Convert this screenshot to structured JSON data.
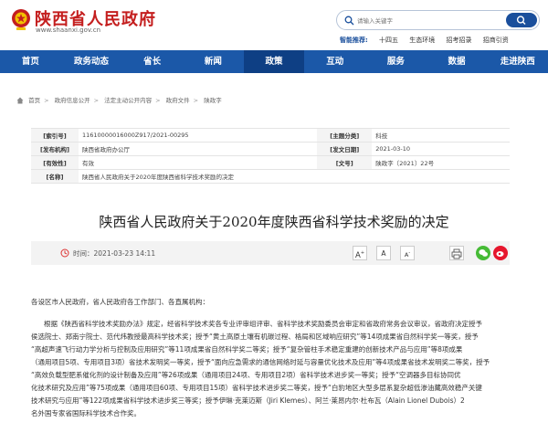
{
  "header": {
    "site_title": "陕西省人民政府",
    "site_url": "www.shaanxi.gov.cn",
    "search_placeholder": "请输入关键字",
    "smart_label": "智能推荐:",
    "smart_items": [
      "十四五",
      "生态环境",
      "招考招录",
      "招商引资"
    ]
  },
  "nav": {
    "items": [
      "首页",
      "政务动态",
      "省长",
      "新闻",
      "政策",
      "互动",
      "服务",
      "数据",
      "走进陕西"
    ],
    "active_index": 4
  },
  "breadcrumb": [
    "首页",
    "政府信息公开",
    "法定主动公开内容",
    "政府文件",
    "陕政字"
  ],
  "meta": {
    "index_label": "[索引号]",
    "index_value": "11610000016000Z917/2021-00295",
    "topic_label": "[主题分类]",
    "topic_value": "科技",
    "org_label": "[发布机构]",
    "org_value": "陕西省政府办公厅",
    "date_label": "[发文日期]",
    "date_value": "2021-03-10",
    "valid_label": "[有效性]",
    "valid_value": "有效",
    "docno_label": "[文号]",
    "docno_value": "陕政字〔2021〕22号",
    "name_label": "[名称]",
    "name_value": "陕西省人民政府关于2020年度陕西省科学技术奖励的决定"
  },
  "article": {
    "title": "陕西省人民政府关于2020年度陕西省科学技术奖励的决定",
    "date": "2021-03-23 14:11",
    "font_large": "A",
    "font_medium": "A",
    "font_small": "A",
    "greeting": "各设区市人民政府，省人民政府各工作部门、各直属机构：",
    "lines": [
      "根据《陕西省科学技术奖励办法》规定，经省科学技术奖各专业评审组评审、省科学技术奖励委员会审定和省政府常务会议审议，省政府决定授予",
      "侯选院士、郑南宁院士、范代炜教授最高科学技术奖；授予“黄土高原土壤有机碳过程、格局和区域响应研究”等14项成果省自然科学奖一等奖，授予",
      "“高超声速飞行动力学分析与控制及应用研究”等11项成果省自然科学奖二等奖；授予“复杂管柱手术稳定重建的创新技术产品与应用”等8项成果",
      "（通用项目5项、专用项目3项）省技术发明奖一等奖，授予“面向应急需求的通信网络时延与容量优化技术及应用”等4项成果省技术发明奖二等奖，授予",
      "“高效负载型肥系催化剂的设计制备及应用”等26项成果（通用项目24项、专用项目2项）省科学技术进步奖一等奖；授予“空调器多目标协同优",
      "化技术研究及应用”等75项成果（通用项目60项、专用项目15项）省科学技术进步奖二等奖，授予“白豹地区大型多层系复杂超低渗油藏高效稳产关键",
      "技术研究与应用”等122项成果省科学技术进步奖三等奖；授予伊琳·克莱迈斯（Jiri Klemes）、阿兰·莱昂内尔·杜布瓦（Alain Lionel Dubois）2",
      "名外国专家省国际科学技术合作奖。"
    ]
  },
  "colors": {
    "brand_red": "#c41e1e",
    "nav_blue": "#1b58a8",
    "nav_active": "#0e3f84"
  }
}
